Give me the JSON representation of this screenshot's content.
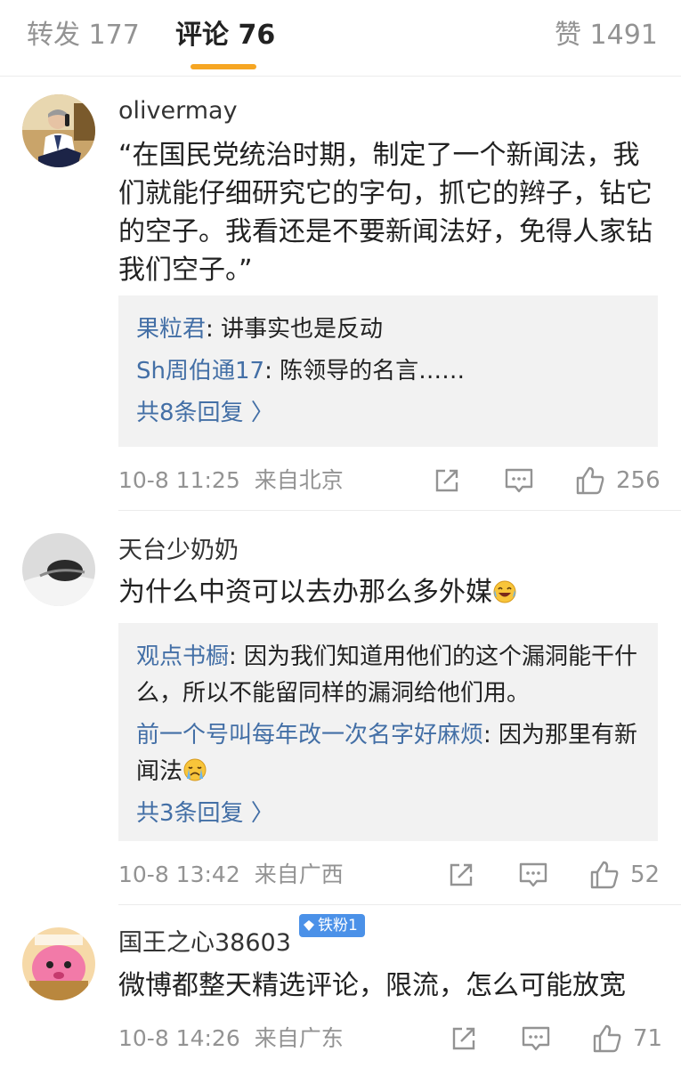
{
  "tabs": {
    "reposts": "转发 177",
    "comments": "评论 76",
    "likes": "赞 1491"
  },
  "colors": {
    "accent": "#f6a623",
    "link": "#436fa6",
    "muted": "#939393",
    "badge": "#4b91e8"
  },
  "comments": [
    {
      "username": "olivermay",
      "content": "“在国民党统治时期，制定了一个新闻法，我们就能仔细研究它的字句，抓它的辫子，钻它的空子。我看还是不要新闻法好，免得人家钻我们空子。”",
      "replies": [
        {
          "user": "果粒君",
          "text": ": 讲事实也是反动"
        },
        {
          "user": "Sh周伯通17",
          "text": ": 陈领导的名言……"
        }
      ],
      "more": "共8条回复 〉",
      "time": "10-8 11:25",
      "source": "来自北京",
      "likes": "256",
      "avatar_icon": "person-on-phone-avatar"
    },
    {
      "username": "天台少奶奶",
      "content": "为什么中资可以去办那么多外媒",
      "content_emoji": "laugh-cry-emoji",
      "replies": [
        {
          "user": "观点书橱",
          "text": ": 因为我们知道用他们的这个漏洞能干什么，所以不能留同样的漏洞给他们用。"
        },
        {
          "user": "前一个号叫每年改一次名字好麻烦",
          "text": ": 因为那里有新闻法",
          "emoji": "crying-emoji"
        }
      ],
      "more": "共3条回复 〉",
      "time": "10-8 13:42",
      "source": "来自广西",
      "likes": "52",
      "avatar_icon": "grayscale-photo-avatar"
    },
    {
      "username": "国王之心38603",
      "badge": "铁粉1",
      "content": "微博都整天精选评论，限流，怎么可能放宽",
      "time": "10-8 14:26",
      "source": "来自广东",
      "likes": "71",
      "avatar_icon": "pink-cartoon-avatar"
    }
  ]
}
